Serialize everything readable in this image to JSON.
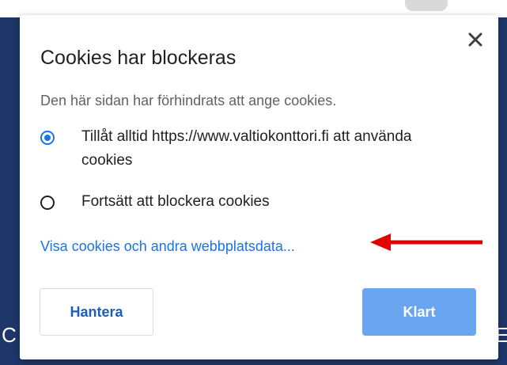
{
  "dialog": {
    "title": "Cookies har blockeras",
    "description": "Den här sidan har förhindrats att ange cookies.",
    "options": [
      {
        "label": "Tillåt alltid https://www.valtiokonttori.fi att använda cookies",
        "selected": true
      },
      {
        "label": "Fortsätt att blockera cookies",
        "selected": false
      }
    ],
    "link_text": "Visa cookies och andra webbplatsdata...",
    "buttons": {
      "manage": "Hantera",
      "done": "Klart"
    },
    "close_icon": "close-icon"
  },
  "background": {
    "hint_left": "C",
    "hint_right": "E"
  },
  "colors": {
    "accent": "#1a73e8",
    "primary_button": "#6aa6f0",
    "annotation_arrow": "#e00000",
    "page_background": "#1f3768"
  }
}
